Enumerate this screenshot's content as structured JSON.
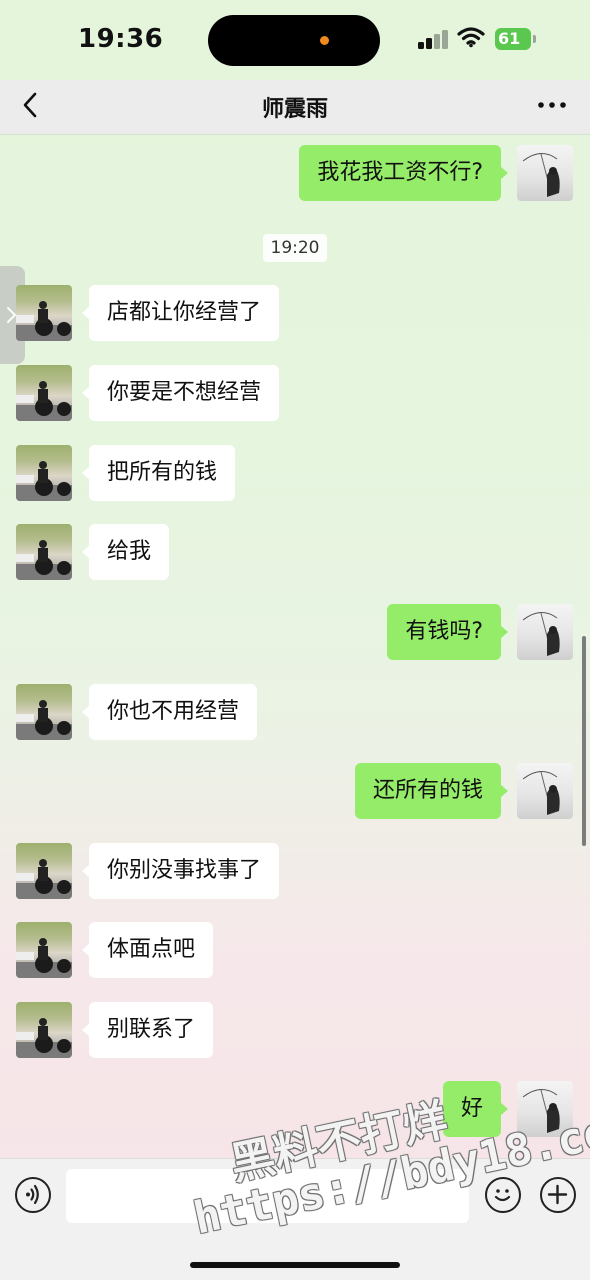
{
  "status_bar": {
    "time": "19:36",
    "battery": "61",
    "colors": {
      "battery": "#5ac84e",
      "island_dot": "#f08a1c"
    },
    "icons": [
      "signal-icon",
      "wifi-icon",
      "battery-icon"
    ]
  },
  "header": {
    "title": "师震雨",
    "back_icon": "chevron-left-icon",
    "more_icon": "more-dots-icon"
  },
  "chat": {
    "colors": {
      "my_bubble": "#95ec69",
      "other_bubble": "#ffffff"
    },
    "messages": [
      {
        "from": "me",
        "text": "我花我工资不行?"
      },
      {
        "type": "time",
        "text": "19:20"
      },
      {
        "from": "other",
        "text": "店都让你经营了"
      },
      {
        "from": "other",
        "text": "你要是不想经营"
      },
      {
        "from": "other",
        "text": "把所有的钱"
      },
      {
        "from": "other",
        "text": "给我"
      },
      {
        "from": "me",
        "text": "有钱吗?"
      },
      {
        "from": "other",
        "text": "你也不用经营"
      },
      {
        "from": "me",
        "text": "还所有的钱"
      },
      {
        "from": "other",
        "text": "你别没事找事了"
      },
      {
        "from": "other",
        "text": "体面点吧"
      },
      {
        "from": "other",
        "text": "别联系了"
      },
      {
        "from": "me",
        "text": "好"
      }
    ]
  },
  "input_bar": {
    "icons": [
      "voice-icon",
      "emoji-icon",
      "plus-icon"
    ]
  },
  "watermark": {
    "line1": "黑料不打烊",
    "line2": "https://bdy18.co"
  }
}
